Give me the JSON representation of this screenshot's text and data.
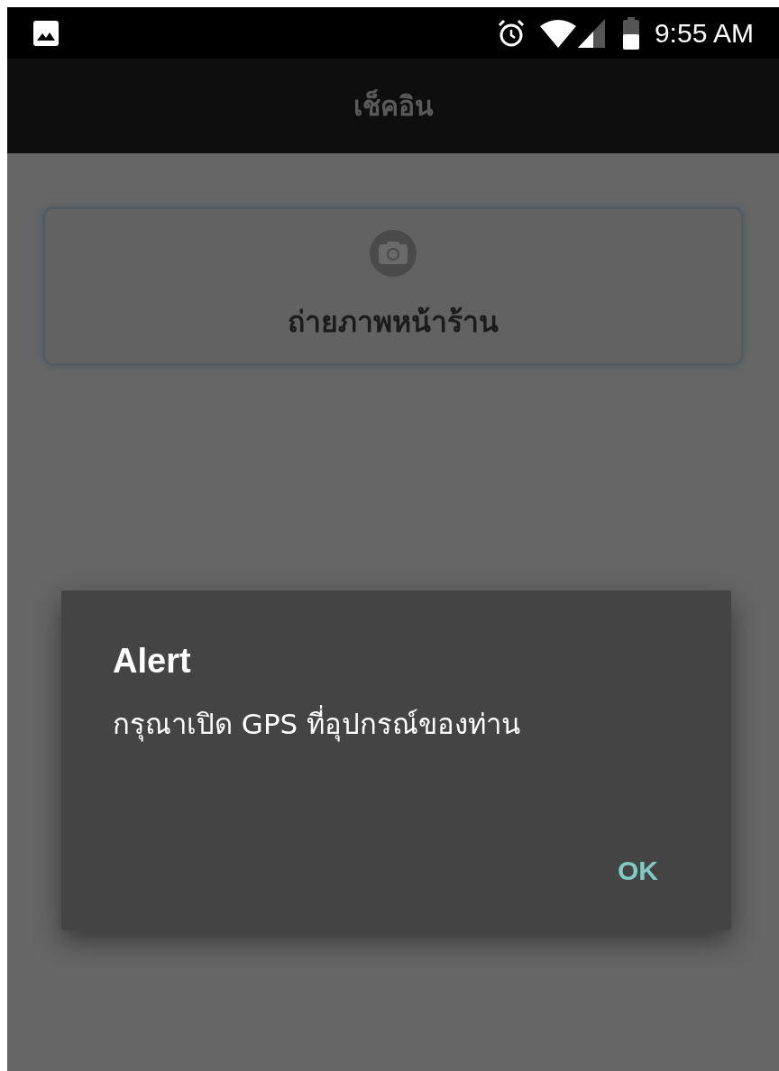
{
  "status_bar": {
    "time": "9:55 AM"
  },
  "app_bar": {
    "title": "เช็คอิน"
  },
  "photo_button": {
    "label": "ถ่ายภาพหน้าร้าน"
  },
  "dialog": {
    "title": "Alert",
    "message": "กรุณาเปิด GPS ที่อุปกรณ์ของท่าน",
    "buttons": [
      "OK"
    ]
  }
}
